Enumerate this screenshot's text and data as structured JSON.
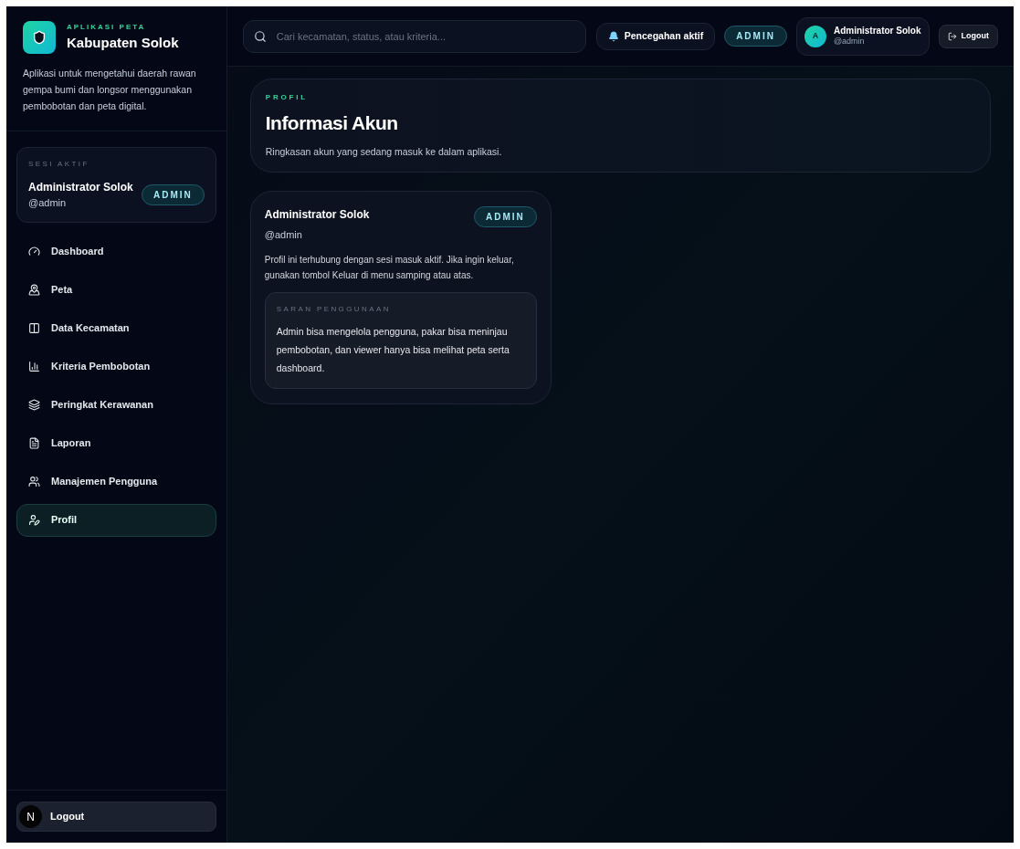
{
  "brand": {
    "eyebrow": "APLIKASI PETA",
    "title": "Kabupaten Solok",
    "description": "Aplikasi untuk mengetahui daerah rawan gempa bumi dan longsor menggunakan pembobotan dan peta digital."
  },
  "session": {
    "label": "SESI AKTIF",
    "name": "Administrator Solok",
    "username": "@admin",
    "role": "ADMIN"
  },
  "nav": [
    {
      "label": "Dashboard",
      "selected": false
    },
    {
      "label": "Peta",
      "selected": false
    },
    {
      "label": "Data Kecamatan",
      "selected": false
    },
    {
      "label": "Kriteria Pembobotan",
      "selected": false
    },
    {
      "label": "Peringkat Kerawanan",
      "selected": false
    },
    {
      "label": "Laporan",
      "selected": false
    },
    {
      "label": "Manajemen Pengguna",
      "selected": false
    },
    {
      "label": "Profil",
      "selected": true
    }
  ],
  "sidebar_logout": {
    "label": "Logout",
    "dev_badge": "N"
  },
  "topbar": {
    "search_placeholder": "Cari kecamatan, status, atau kriteria...",
    "alert": "Pencegahan aktif",
    "role": "ADMIN",
    "user": {
      "initial": "A",
      "name": "Administrator Solok",
      "username": "@admin"
    },
    "logout": "Logout"
  },
  "header": {
    "eyebrow": "PROFIL",
    "title": "Informasi Akun",
    "subtitle": "Ringkasan akun yang sedang masuk ke dalam aplikasi."
  },
  "profile_card": {
    "name": "Administrator Solok",
    "username": "@admin",
    "role": "ADMIN",
    "description": "Profil ini terhubung dengan sesi masuk aktif. Jika ingin keluar, gunakan tombol Keluar di menu samping atau atas.",
    "tip": {
      "label": "SARAN PENGGUNAAN",
      "text": "Admin bisa mengelola pengguna, pakar bisa meninjau pembobotan, dan viewer hanya bisa melihat peta serta dashboard."
    }
  }
}
